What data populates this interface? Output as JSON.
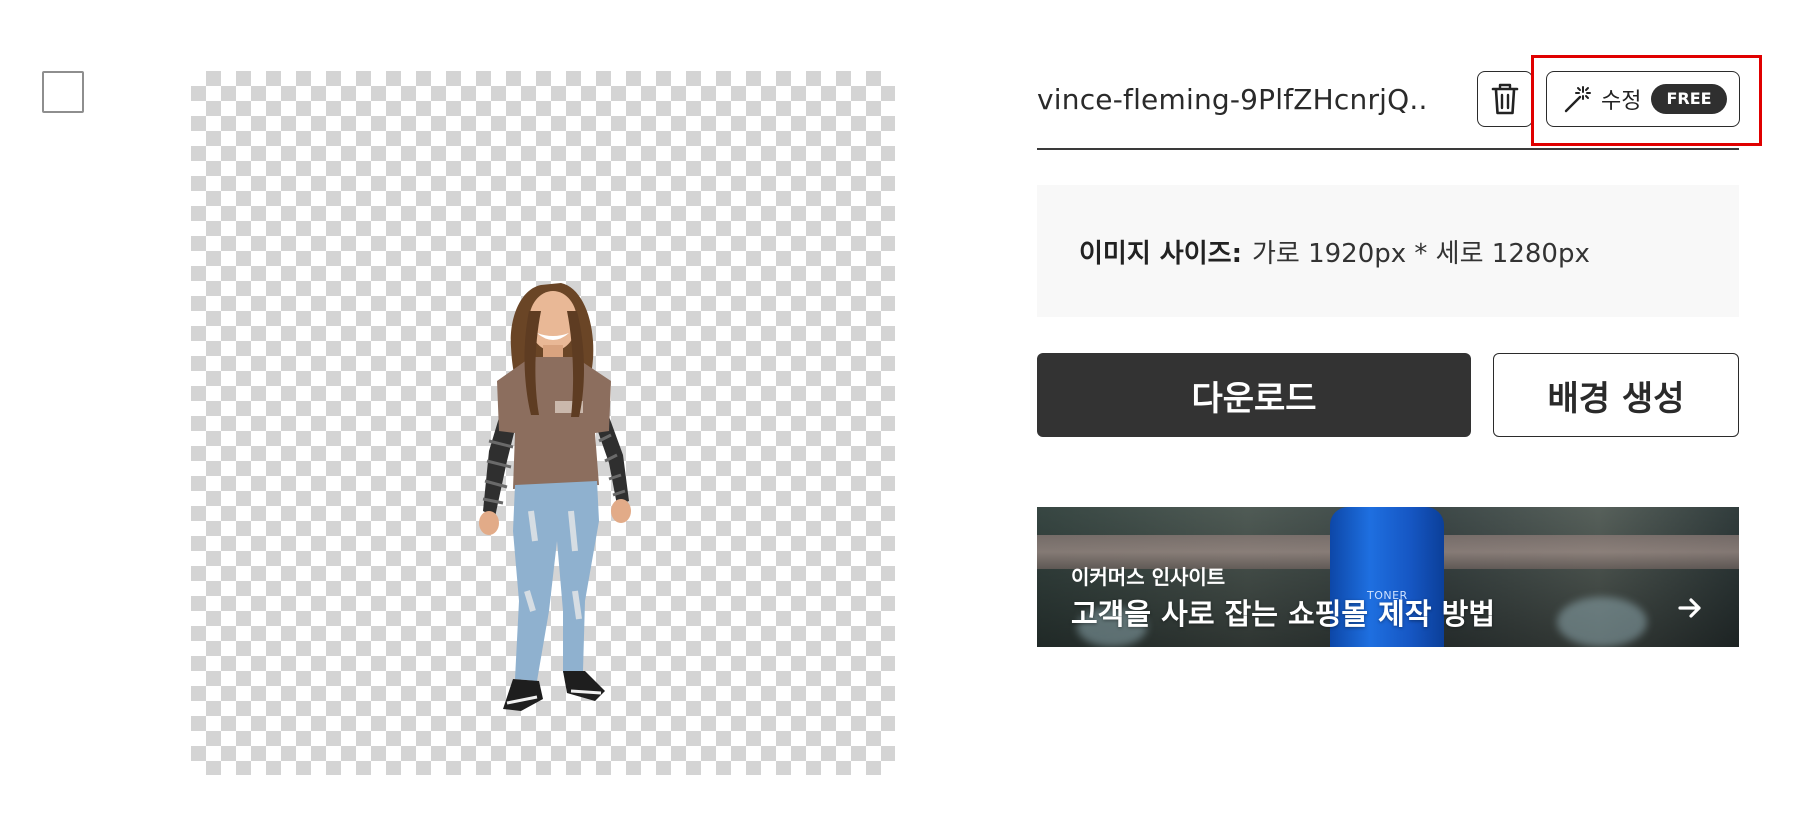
{
  "file": {
    "name": "vince-fleming-9PlfZHcnrjQ..."
  },
  "actions": {
    "delete_icon": "trash-icon",
    "edit_icon": "magic-wand-icon",
    "edit_label": "수정",
    "edit_badge": "FREE"
  },
  "info": {
    "size_label": "이미지 사이즈:",
    "size_value": "가로 1920px * 세로 1280px"
  },
  "buttons": {
    "download": "다운로드",
    "generate_background": "배경 생성"
  },
  "banner": {
    "kicker": "이커머스 인사이트",
    "headline": "고객을 사로 잡는 쇼핑몰 제작 방법",
    "product_label": "TONER",
    "arrow_icon": "arrow-right-icon"
  },
  "colors": {
    "primary_button": "#333333",
    "highlight": "#e00000",
    "badge": "#2f2f2f",
    "bottle_blue": "#1e6fe0"
  }
}
